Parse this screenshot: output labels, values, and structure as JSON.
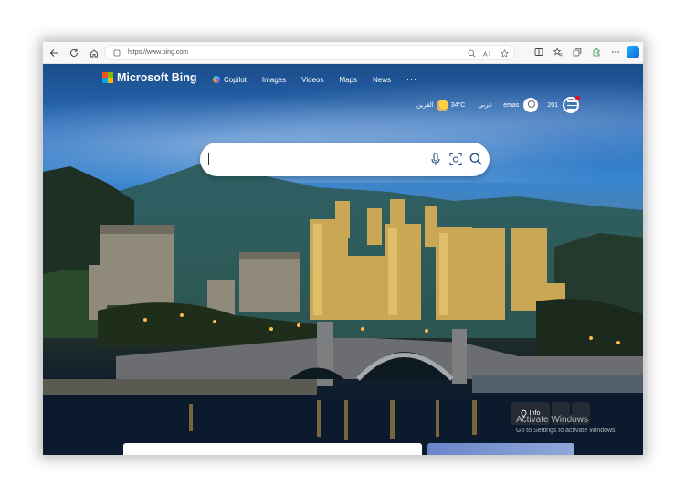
{
  "browser": {
    "url": "https://www.bing.com",
    "toolbar_icons": [
      "back-icon",
      "refresh-icon",
      "home-icon",
      "info-icon",
      "zoom-icon",
      "read-aloud-icon",
      "favorite-icon",
      "split-screen-icon",
      "favorites-icon",
      "collections-icon",
      "extensions-icon",
      "more-icon",
      "copilot-icon"
    ]
  },
  "header": {
    "logo_text": "Microsoft Bing",
    "nav": [
      {
        "label": "Copilot"
      },
      {
        "label": "Images"
      },
      {
        "label": "Videos"
      },
      {
        "label": "Maps"
      },
      {
        "label": "News"
      }
    ],
    "nav_more": "···",
    "weather_location": "القرين",
    "temperature": "34°C",
    "language": "عربي",
    "user_name": "emas",
    "reward_points": "201"
  },
  "search": {
    "value": "",
    "placeholder": ""
  },
  "info_chip": {
    "label": "Info"
  },
  "watermark": {
    "title": "Activate Windows",
    "subtitle": "Go to Settings to activate Windows."
  },
  "colors": {
    "logo_red": "#f25022",
    "logo_green": "#7fba00",
    "logo_blue": "#00a4ef",
    "logo_yellow": "#ffb900",
    "reward_dot": "#e81123"
  }
}
